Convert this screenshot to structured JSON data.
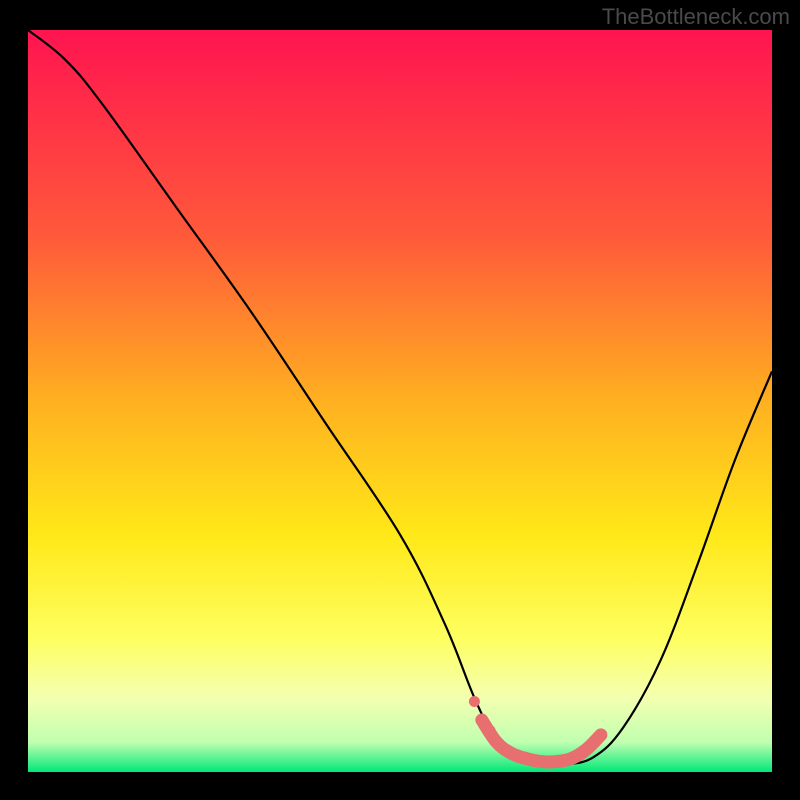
{
  "watermark": "TheBottleneck.com",
  "chart_data": {
    "type": "line",
    "title": "",
    "xlabel": "",
    "ylabel": "",
    "xlim": [
      0,
      100
    ],
    "ylim": [
      0,
      100
    ],
    "gradient_stops": [
      {
        "offset": 0,
        "color": "#ff1450"
      },
      {
        "offset": 0.28,
        "color": "#ff5a3a"
      },
      {
        "offset": 0.5,
        "color": "#ffb020"
      },
      {
        "offset": 0.68,
        "color": "#ffe818"
      },
      {
        "offset": 0.82,
        "color": "#feff60"
      },
      {
        "offset": 0.9,
        "color": "#f4ffb0"
      },
      {
        "offset": 0.96,
        "color": "#c0ffb0"
      },
      {
        "offset": 1.0,
        "color": "#00e878"
      }
    ],
    "curve": [
      {
        "x": 0,
        "y": 100
      },
      {
        "x": 5,
        "y": 96
      },
      {
        "x": 10,
        "y": 90
      },
      {
        "x": 20,
        "y": 76
      },
      {
        "x": 30,
        "y": 62
      },
      {
        "x": 40,
        "y": 47
      },
      {
        "x": 50,
        "y": 32
      },
      {
        "x": 56,
        "y": 20
      },
      {
        "x": 60,
        "y": 10
      },
      {
        "x": 63,
        "y": 4
      },
      {
        "x": 65,
        "y": 2
      },
      {
        "x": 68,
        "y": 1
      },
      {
        "x": 72,
        "y": 1
      },
      {
        "x": 76,
        "y": 2
      },
      {
        "x": 80,
        "y": 6
      },
      {
        "x": 85,
        "y": 15
      },
      {
        "x": 90,
        "y": 28
      },
      {
        "x": 95,
        "y": 42
      },
      {
        "x": 100,
        "y": 54
      }
    ],
    "highlight_segment": [
      {
        "x": 61,
        "y": 7
      },
      {
        "x": 63,
        "y": 4
      },
      {
        "x": 65,
        "y": 2.5
      },
      {
        "x": 67,
        "y": 1.8
      },
      {
        "x": 69,
        "y": 1.4
      },
      {
        "x": 71,
        "y": 1.4
      },
      {
        "x": 73,
        "y": 1.8
      },
      {
        "x": 75,
        "y": 3
      },
      {
        "x": 77,
        "y": 5
      }
    ],
    "highlight_dots": [
      {
        "x": 60,
        "y": 9.5
      },
      {
        "x": 62,
        "y": 5.5
      }
    ],
    "colors": {
      "curve": "#000000",
      "highlight": "#e76f6f",
      "background_frame": "#000000"
    }
  }
}
